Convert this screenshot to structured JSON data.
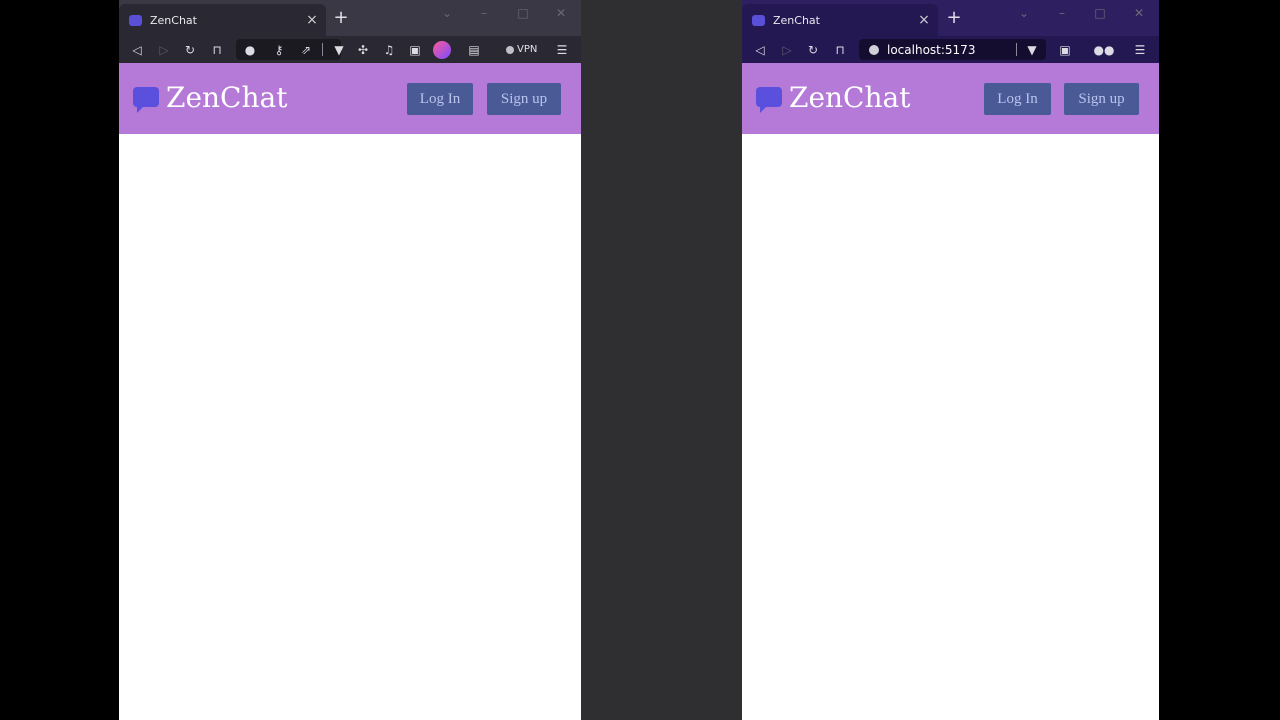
{
  "left_window": {
    "tab_title": "ZenChat",
    "vpn_label": "VPN",
    "brand": "ZenChat",
    "login_label": "Log In",
    "signup_label": "Sign up"
  },
  "right_window": {
    "tab_title": "ZenChat",
    "url": "localhost:5173",
    "brand": "ZenChat",
    "login_label": "Log In",
    "signup_label": "Sign up"
  },
  "colors": {
    "header_bg": "#b57ad8",
    "button_bg": "#4a5a96",
    "brand_icon": "#5b4fdd",
    "desktop_gap": "#2f2f31"
  },
  "icons": [
    "zenchat-tab-icon",
    "close-icon",
    "new-tab-icon",
    "back-icon",
    "forward-icon",
    "reload-icon",
    "bookmark-icon",
    "site-info-icon",
    "key-icon",
    "share-icon",
    "brave-shield-icon",
    "extensions-icon",
    "media-icon",
    "sidebar-icon",
    "wallet-icon",
    "menu-icon",
    "reader-icon",
    "chat-bubble-icon"
  ]
}
